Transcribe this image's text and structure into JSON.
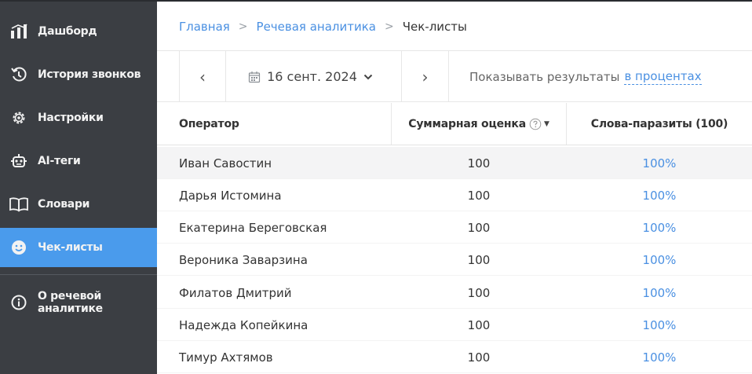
{
  "sidebar": {
    "items": [
      {
        "label": "Дашборд",
        "icon": "dashboard-icon"
      },
      {
        "label": "История звонков",
        "icon": "call-history-icon"
      },
      {
        "label": "Настройки",
        "icon": "gear-icon"
      },
      {
        "label": "AI-теги",
        "icon": "robot-icon"
      },
      {
        "label": "Словари",
        "icon": "book-icon"
      },
      {
        "label": "Чек-листы",
        "icon": "smiley-icon",
        "active": true
      },
      {
        "label": "О речевой аналитике",
        "icon": "info-icon"
      }
    ]
  },
  "breadcrumb": {
    "home": "Главная",
    "section": "Речевая аналитика",
    "current": "Чек-листы"
  },
  "toolbar": {
    "date": "16 сент. 2024",
    "show_label": "Показывать результаты",
    "show_mode": "в процентах"
  },
  "table": {
    "headers": {
      "operator": "Оператор",
      "total": "Суммарная оценка",
      "filler_words": "Слова-паразиты (100)"
    },
    "rows": [
      {
        "name": "Иван Савостин",
        "total": "100",
        "filler": "100%"
      },
      {
        "name": "Дарья Истомина",
        "total": "100",
        "filler": "100%"
      },
      {
        "name": "Екатерина Береговская",
        "total": "100",
        "filler": "100%"
      },
      {
        "name": "Вероника Заварзина",
        "total": "100",
        "filler": "100%"
      },
      {
        "name": "Филатов Дмитрий",
        "total": "100",
        "filler": "100%"
      },
      {
        "name": "Надежда Копейкина",
        "total": "100",
        "filler": "100%"
      },
      {
        "name": "Тимур Ахтямов",
        "total": "100",
        "filler": "100%"
      }
    ]
  },
  "colors": {
    "sidebar_bg": "#3b3e43",
    "active": "#4a9bec",
    "link": "#4a90e2"
  }
}
